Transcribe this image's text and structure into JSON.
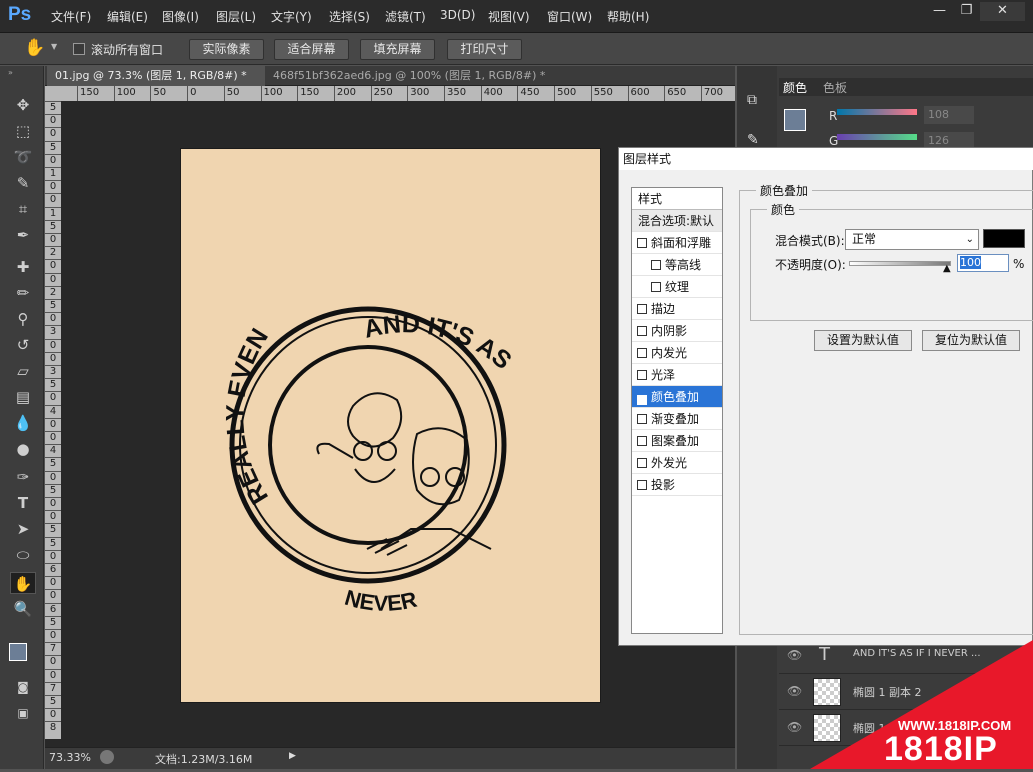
{
  "app": {
    "logo": "Ps"
  },
  "menus": [
    "文件(F)",
    "编辑(E)",
    "图像(I)",
    "图层(L)",
    "文字(Y)",
    "选择(S)",
    "滤镜(T)",
    "3D(D)",
    "视图(V)",
    "窗口(W)",
    "帮助(H)"
  ],
  "window_controls": {
    "minimize": "—",
    "restore": "❐",
    "close": "✕"
  },
  "options": {
    "scroll_all_label": "滚动所有窗口",
    "buttons": [
      "实际像素",
      "适合屏幕",
      "填充屏幕",
      "打印尺寸"
    ]
  },
  "tabs": [
    {
      "label": "01.jpg @ 73.3% (图层 1, RGB/8#) *",
      "active": true
    },
    {
      "label": "468f51bf362aed6.jpg @ 100% (图层 1, RGB/8#) *",
      "active": false
    }
  ],
  "ruler_h": [
    "150",
    "100",
    "50",
    "0",
    "50",
    "100",
    "150",
    "200",
    "250",
    "300",
    "350",
    "400",
    "450",
    "500",
    "550",
    "600",
    "650",
    "700"
  ],
  "ruler_v": [
    "5",
    "0",
    "0",
    "5",
    "0",
    "1",
    "0",
    "0",
    "1",
    "5",
    "0",
    "2",
    "0",
    "0",
    "2",
    "5",
    "0",
    "3",
    "0",
    "0",
    "3",
    "5",
    "0",
    "4",
    "0",
    "0",
    "4",
    "5",
    "0",
    "5",
    "0",
    "0",
    "5",
    "5",
    "0",
    "6",
    "0",
    "0",
    "6",
    "5",
    "0",
    "7",
    "0",
    "0",
    "7",
    "5",
    "0",
    "8"
  ],
  "status": {
    "zoom": "73.33%",
    "doc": "文档:1.23M/3.16M"
  },
  "artwork": {
    "top_text": "AND IT'S AS IF",
    "bottom_text": "NEVER",
    "left_text": "REALLY EVEN"
  },
  "color_panel": {
    "tabs": [
      "颜色",
      "色板"
    ],
    "r_label": "R",
    "r_value": "108",
    "g_label": "G",
    "g_value": "126"
  },
  "layers": [
    {
      "name": "AND IT'S AS IF I NEVER ...",
      "type": "text"
    },
    {
      "name": "椭圆 1 副本 2",
      "type": "shape"
    },
    {
      "name": "椭圆 1",
      "type": "shape"
    }
  ],
  "dialog": {
    "title": "图层样式",
    "list_header": "样式",
    "blend_options": "混合选项:默认",
    "items": [
      {
        "label": "斜面和浮雕",
        "checked": false,
        "indent": false
      },
      {
        "label": "等高线",
        "checked": false,
        "indent": true
      },
      {
        "label": "纹理",
        "checked": false,
        "indent": true
      },
      {
        "label": "描边",
        "checked": false,
        "indent": false
      },
      {
        "label": "内阴影",
        "checked": false,
        "indent": false
      },
      {
        "label": "内发光",
        "checked": false,
        "indent": false
      },
      {
        "label": "光泽",
        "checked": false,
        "indent": false
      },
      {
        "label": "颜色叠加",
        "checked": true,
        "indent": false,
        "selected": true
      },
      {
        "label": "渐变叠加",
        "checked": false,
        "indent": false
      },
      {
        "label": "图案叠加",
        "checked": false,
        "indent": false
      },
      {
        "label": "外发光",
        "checked": false,
        "indent": false
      },
      {
        "label": "投影",
        "checked": false,
        "indent": false
      }
    ],
    "section_title": "颜色叠加",
    "group_title": "颜色",
    "blend_mode_label": "混合模式(B):",
    "blend_mode_value": "正常",
    "overlay_color": "#000000",
    "opacity_label": "不透明度(O):",
    "opacity_value": "100",
    "opacity_unit": "%",
    "set_default": "设置为默认值",
    "reset_default": "复位为默认值"
  },
  "watermark": {
    "url": "WWW.1818IP.COM",
    "brand": "1818IP"
  }
}
